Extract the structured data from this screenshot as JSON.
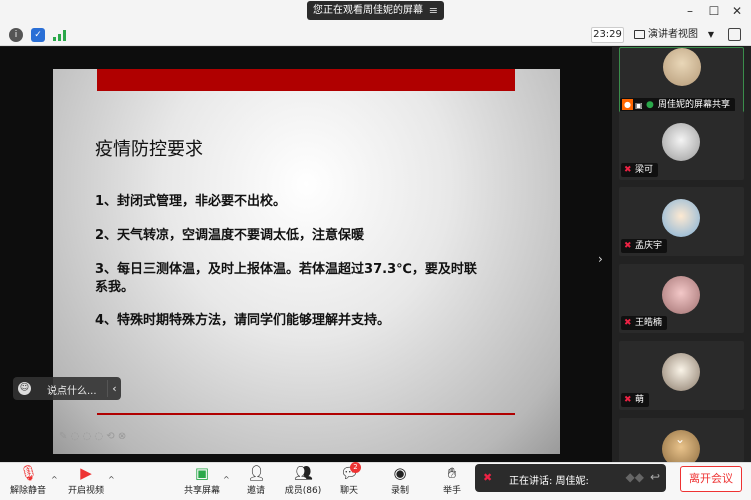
{
  "title_bar": {
    "share_notice": "您正在观看周佳妮的屏幕",
    "menu_glyph": "≡"
  },
  "info_bar": {
    "timer": "23:29",
    "view_mode": "演讲者视图"
  },
  "slide": {
    "title": "疫情防控要求",
    "items": [
      "1、封闭式管理，非必要不出校。",
      "2、天气转凉，空调温度不要调太低，注意保暖",
      "3、每日三测体温，及时上报体温。若体温超过37.3℃，要及时联",
      "系我。",
      "4、特殊时期特殊方法，请同学们能够理解并支持。"
    ]
  },
  "chat_input": {
    "placeholder": "说点什么..."
  },
  "participants": [
    {
      "name": "周佳妮的屏幕共享"
    },
    {
      "name": "梁可"
    },
    {
      "name": "孟庆宇"
    },
    {
      "name": "王皓楠"
    },
    {
      "name": "萌"
    },
    {
      "name": ""
    }
  ],
  "toolbar": {
    "unmute": "解除静音",
    "start_video": "开启视频",
    "share_screen": "共享屏幕",
    "invite": "邀请",
    "members": "成员(86)",
    "chat": "聊天",
    "chat_badge": "2",
    "record": "录制",
    "raise_hand": "举手",
    "speaking": "正在讲话: 周佳妮:",
    "leave": "离开会议"
  },
  "colors": {
    "accent_red": "#b00000",
    "leave_red": "#ee3333",
    "active_tile": "#3a8d4b"
  }
}
